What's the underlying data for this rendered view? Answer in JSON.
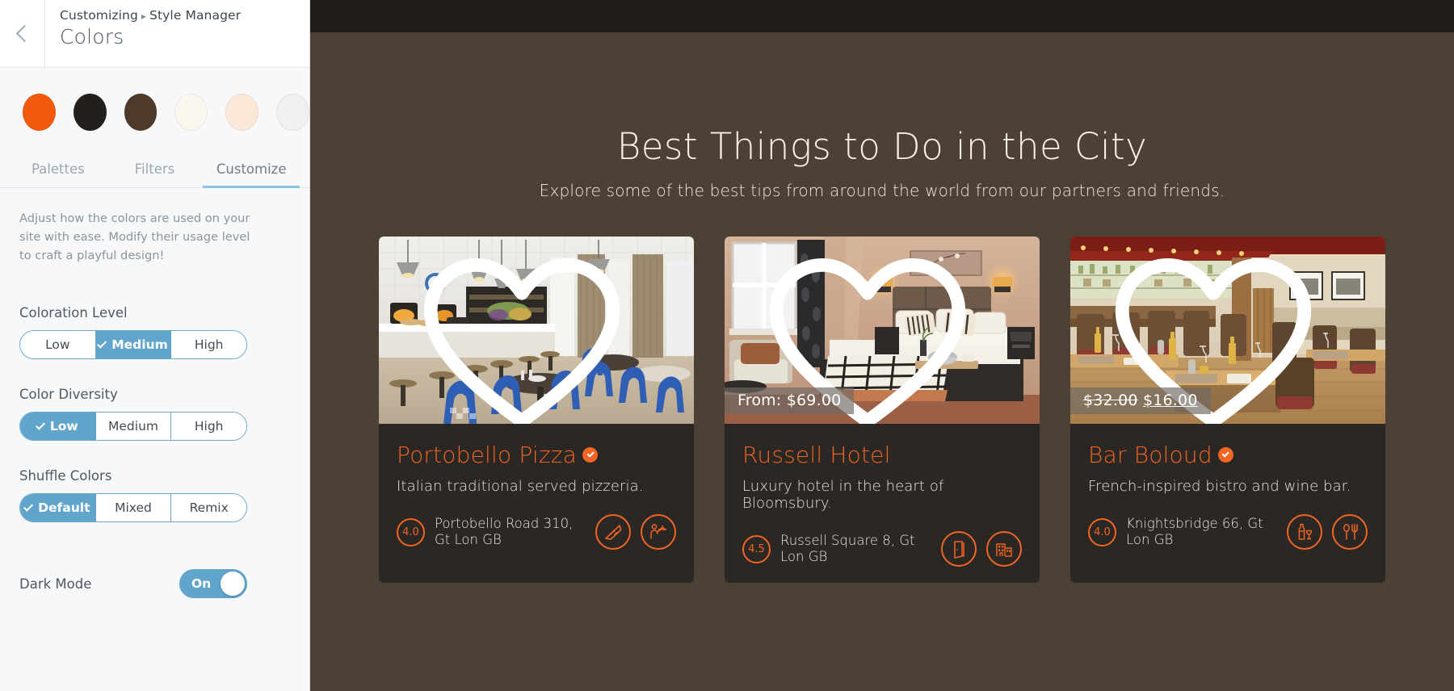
{
  "panel": {
    "back_icon": "chevron-left-icon",
    "breadcrumb_parent": "Customizing",
    "breadcrumb_sep": "▸",
    "breadcrumb_current": "Style Manager",
    "title": "Colors",
    "swatches": [
      {
        "name": "swatch-orange",
        "color": "#f05a0a"
      },
      {
        "name": "swatch-black",
        "color": "#231f1c"
      },
      {
        "name": "swatch-brown",
        "color": "#4d3a2b"
      },
      {
        "name": "swatch-cream",
        "color": "#fbf6ef"
      },
      {
        "name": "swatch-peach",
        "color": "#fbe8d8"
      },
      {
        "name": "swatch-grey",
        "color": "#eef0f2"
      }
    ],
    "tabs": [
      {
        "label": "Palettes",
        "active": false
      },
      {
        "label": "Filters",
        "active": false
      },
      {
        "label": "Customize",
        "active": true
      }
    ],
    "description": "Adjust how the colors are used on your site with ease. Modify their usage level to craft a playful design!",
    "controls": [
      {
        "label": "Coloration Level",
        "options": [
          {
            "label": "Low",
            "selected": false
          },
          {
            "label": "Medium",
            "selected": true
          },
          {
            "label": "High",
            "selected": false
          }
        ]
      },
      {
        "label": "Color Diversity",
        "options": [
          {
            "label": "Low",
            "selected": true
          },
          {
            "label": "Medium",
            "selected": false
          },
          {
            "label": "High",
            "selected": false
          }
        ]
      },
      {
        "label": "Shuffle Colors",
        "options": [
          {
            "label": "Default",
            "selected": true
          },
          {
            "label": "Mixed",
            "selected": false
          },
          {
            "label": "Remix",
            "selected": false
          }
        ]
      }
    ],
    "dark_mode": {
      "label": "Dark Mode",
      "state": "On"
    },
    "accent_color": "#61a5cd"
  },
  "preview": {
    "background": "#4d4035",
    "topbar_color": "#211c18",
    "accent_color": "#f26522",
    "hero": {
      "title": "Best Things to Do in the City",
      "subtitle": "Explore some of the best tips from around the world from our partners and friends."
    },
    "cards": [
      {
        "image_alt": "pizzeria-interior-white-tiles-blue-chairs",
        "favorite_icon": "heart-outline-icon",
        "price": null,
        "old_price": null,
        "title": "Portobello Pizza",
        "verified": true,
        "description": "Italian traditional served pizzeria.",
        "rating": "4.0",
        "address": "Portobello Road 310, Gt Lon GB",
        "icons": [
          "pizza-slice-icon",
          "waiter-tray-icon"
        ]
      },
      {
        "image_alt": "hotel-bedroom-warm-lighting",
        "favorite_icon": "heart-outline-icon",
        "price": "From: $69.00",
        "old_price": null,
        "title": "Russell Hotel",
        "verified": false,
        "description": "Luxury hotel in the heart of Bloomsbury.",
        "rating": "4.5",
        "address": "Russell Square 8, Gt Lon GB",
        "icons": [
          "door-icon",
          "hotel-building-icon"
        ]
      },
      {
        "image_alt": "bistro-wine-bar-wooden-tables",
        "favorite_icon": "heart-outline-icon",
        "price": "$16.00",
        "old_price": "$32.00",
        "title": "Bar Boloud",
        "verified": true,
        "description": "French-inspired bistro and wine bar.",
        "rating": "4.0",
        "address": "Knightsbridge 66, Gt Lon GB",
        "icons": [
          "wine-bottle-glass-icon",
          "cutlery-icon"
        ]
      }
    ]
  }
}
